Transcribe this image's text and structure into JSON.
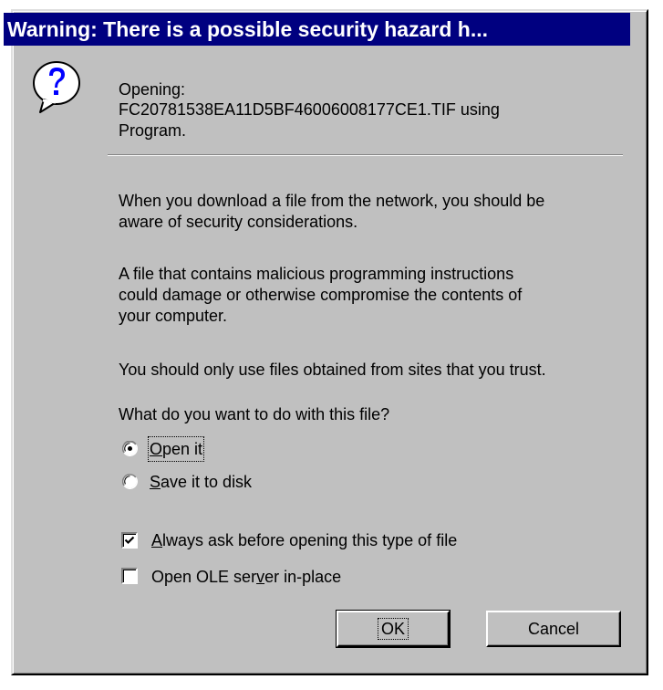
{
  "title": "Warning:  There is a possible security hazard h...",
  "icon": "question-balloon-icon",
  "opening": {
    "line1": "Opening:",
    "line2": "FC20781538EA11D5BF46006008177CE1.TIF using",
    "line3": "Program."
  },
  "paragraphs": {
    "p1_line1": "When you download a file from the network, you should be",
    "p1_line2": "aware of security considerations.",
    "p2_line1": "A file that contains malicious programming instructions",
    "p2_line2": "could damage or otherwise compromise the contents of",
    "p2_line3": "your computer.",
    "p3_line1": "You should only use files obtained from sites that you trust."
  },
  "question": "What do you want to do with this file?",
  "options": {
    "open_mnemonic": "O",
    "open_rest": "pen it",
    "open_selected": true,
    "save_mnemonic": "S",
    "save_rest": "ave it to disk",
    "save_selected": false
  },
  "checkboxes": {
    "always_ask_mnemonic": "A",
    "always_ask_rest": "lways ask before opening this type of file",
    "always_ask_checked": true,
    "ole_prefix": "Open OLE ser",
    "ole_mnemonic": "v",
    "ole_suffix": "er in-place",
    "ole_checked": false
  },
  "buttons": {
    "ok": "OK",
    "cancel": "Cancel"
  },
  "colors": {
    "title_bar": "#000080",
    "face": "#c0c0c0",
    "icon_blue": "#0000ff"
  }
}
